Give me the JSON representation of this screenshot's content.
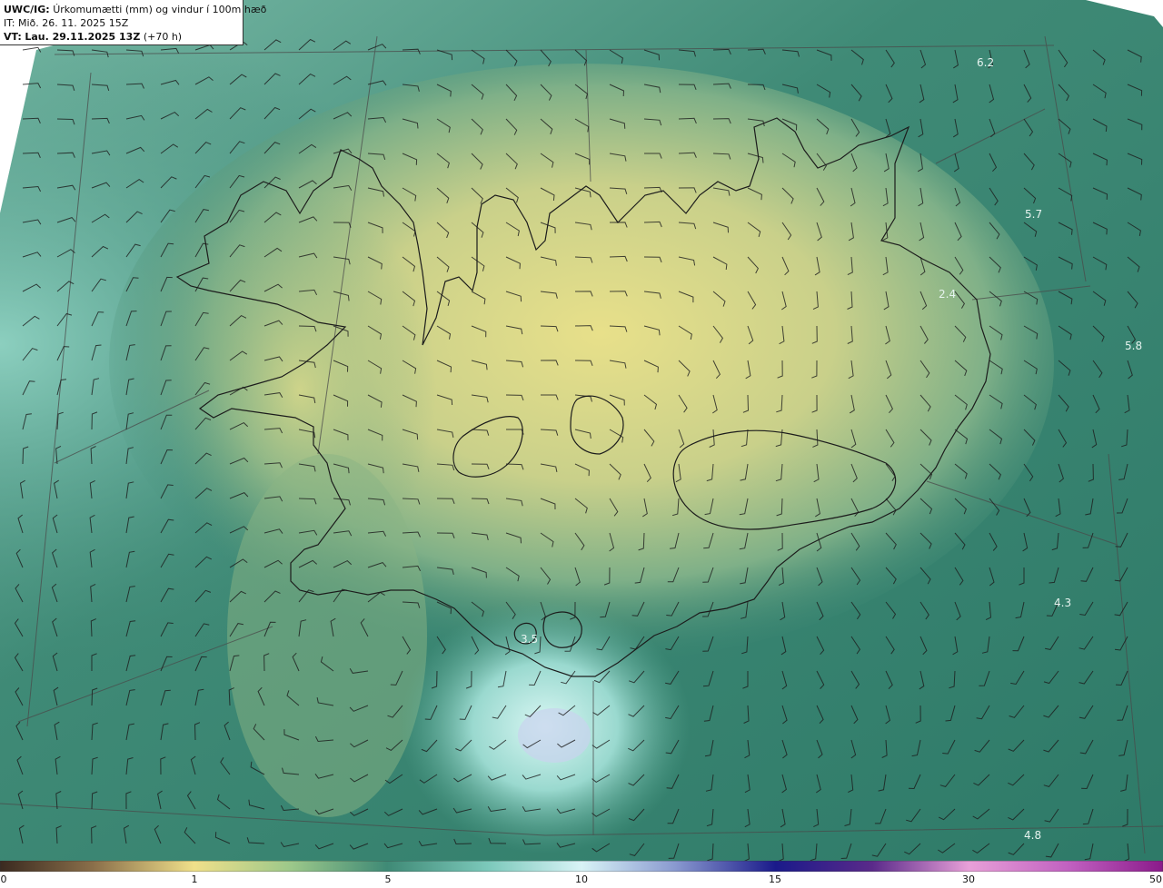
{
  "header": {
    "model_label": "UWC/IG:",
    "title": "Úrkomumætti (mm) og vindur í 100m hæð",
    "init_time": "IT: Mið. 26. 11. 2025 15Z",
    "valid_label": "VT:",
    "valid_time": "Lau. 29.11.2025 13Z",
    "lead": "(+70 h)"
  },
  "colorbar": {
    "ticks": [
      {
        "label": "0",
        "value": 0
      },
      {
        "label": "1",
        "value": 1
      },
      {
        "label": "5",
        "value": 5
      },
      {
        "label": "10",
        "value": 10
      },
      {
        "label": "15",
        "value": 15
      },
      {
        "label": "30",
        "value": 30
      },
      {
        "label": "50",
        "value": 50
      }
    ]
  },
  "map_labels": [
    {
      "text": "6.2"
    },
    {
      "text": "5.7"
    },
    {
      "text": "5.8"
    },
    {
      "text": "2.4"
    },
    {
      "text": "4.3"
    },
    {
      "text": "3.5"
    },
    {
      "text": "4.8"
    }
  ],
  "colors": {
    "ocean": "#3f8a76",
    "land_low": "#6fa882",
    "land_high": "#e8e08a",
    "precip_light": "#b8eee6",
    "coast": "#1c1c1c"
  }
}
